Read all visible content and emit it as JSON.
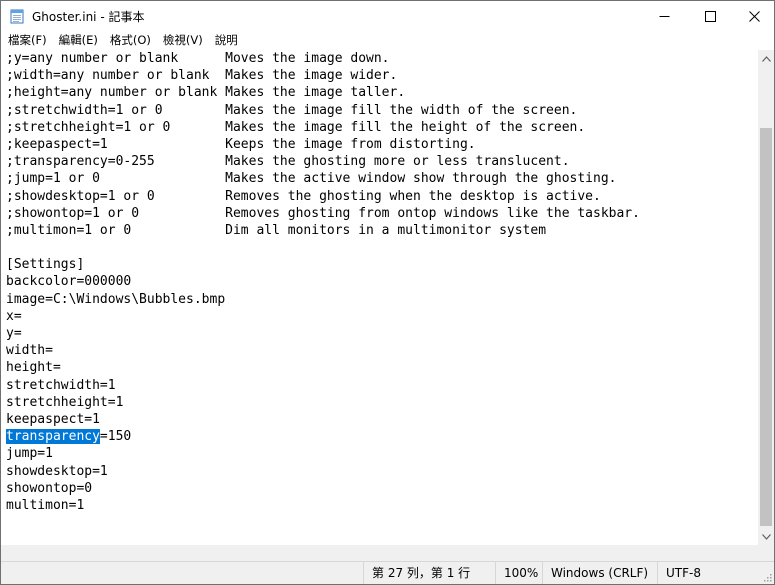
{
  "window": {
    "title": "Ghoster.ini - 記事本",
    "icon": "notepad-icon"
  },
  "menu": [
    {
      "label": "檔案(F)"
    },
    {
      "label": "編輯(E)"
    },
    {
      "label": "格式(O)"
    },
    {
      "label": "檢視(V)"
    },
    {
      "label": "說明"
    }
  ],
  "editor": {
    "lines": [
      {
        "text": ";y=any number or blank      Moves the image down."
      },
      {
        "text": ";width=any number or blank  Makes the image wider."
      },
      {
        "text": ";height=any number or blank Makes the image taller."
      },
      {
        "text": ";stretchwidth=1 or 0        Makes the image fill the width of the screen."
      },
      {
        "text": ";stretchheight=1 or 0       Makes the image fill the height of the screen."
      },
      {
        "text": ";keepaspect=1               Keeps the image from distorting."
      },
      {
        "text": ";transparency=0-255         Makes the ghosting more or less translucent."
      },
      {
        "text": ";jump=1 or 0                Makes the active window show through the ghosting."
      },
      {
        "text": ";showdesktop=1 or 0         Removes the ghosting when the desktop is active."
      },
      {
        "text": ";showontop=1 or 0           Removes ghosting from ontop windows like the taskbar."
      },
      {
        "text": ";multimon=1 or 0            Dim all monitors in a multimonitor system"
      },
      {
        "text": ""
      },
      {
        "text": "[Settings]"
      },
      {
        "text": "backcolor=000000"
      },
      {
        "text": "image=C:\\Windows\\Bubbles.bmp"
      },
      {
        "text": "x="
      },
      {
        "text": "y="
      },
      {
        "text": "width="
      },
      {
        "text": "height="
      },
      {
        "text": "stretchwidth=1"
      },
      {
        "text": "stretchheight=1"
      },
      {
        "text": "keepaspect=1"
      },
      {
        "selected": "transparency",
        "text": "=150"
      },
      {
        "text": "jump=1"
      },
      {
        "text": "showdesktop=1"
      },
      {
        "text": "showontop=0"
      },
      {
        "text": "multimon=1"
      }
    ]
  },
  "status": {
    "position": "第 27 列，第 1 行",
    "zoom": "100%",
    "line_ending": "Windows (CRLF)",
    "encoding": "UTF-8"
  },
  "colors": {
    "selection": "#0078d7",
    "scrollbar_thumb": "#c2c2c2",
    "statusbar_bg": "#f0f0f0"
  }
}
